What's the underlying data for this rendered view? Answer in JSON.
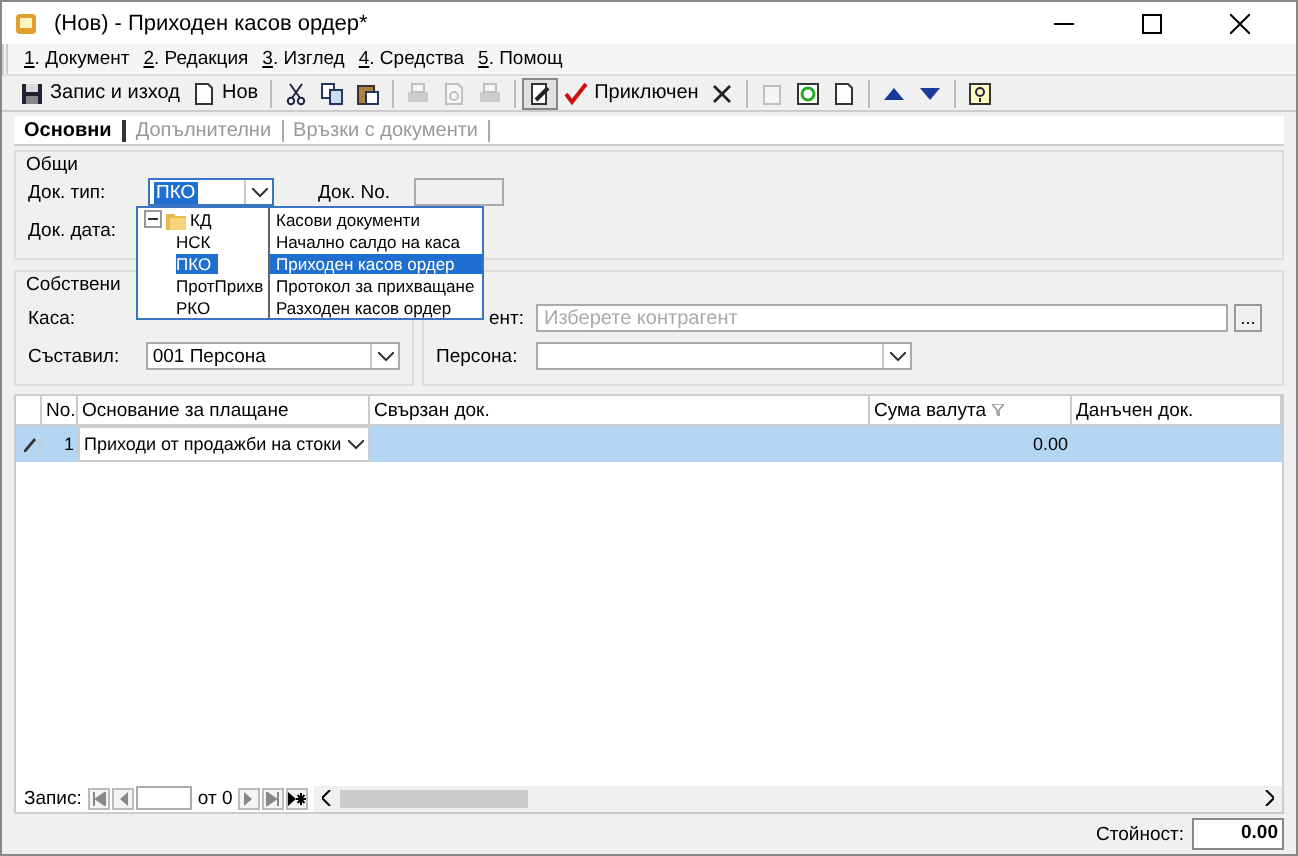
{
  "window": {
    "title": "(Нов) - Приходен касов ордер*"
  },
  "menu": [
    {
      "key": "1",
      "label": ". Документ"
    },
    {
      "key": "2",
      "label": ". Редакция"
    },
    {
      "key": "3",
      "label": ". Изглед"
    },
    {
      "key": "4",
      "label": ". Средства"
    },
    {
      "key": "5",
      "label": ". Помощ"
    }
  ],
  "toolbar": [
    {
      "kind": "button",
      "label": "Запис и изход",
      "disabled": false
    },
    {
      "kind": "button",
      "label": "Нов",
      "disabled": false
    },
    {
      "kind": "separator"
    },
    {
      "kind": "button",
      "disabled": false
    },
    {
      "kind": "button",
      "disabled": false
    },
    {
      "kind": "button",
      "disabled": false
    },
    {
      "kind": "separator"
    },
    {
      "kind": "button",
      "disabled": true
    },
    {
      "kind": "button",
      "disabled": true
    },
    {
      "kind": "button",
      "disabled": true
    },
    {
      "kind": "separator"
    },
    {
      "kind": "toggle",
      "on": true
    },
    {
      "kind": "button",
      "label": "Приключен",
      "disabled": false
    },
    {
      "kind": "button",
      "disabled": false
    },
    {
      "kind": "separator"
    },
    {
      "kind": "button",
      "disabled": true
    },
    {
      "kind": "button",
      "disabled": false
    },
    {
      "kind": "button",
      "disabled": false
    },
    {
      "kind": "separator"
    },
    {
      "kind": "button",
      "disabled": false
    },
    {
      "kind": "button",
      "disabled": false
    },
    {
      "kind": "separator"
    },
    {
      "kind": "button",
      "disabled": false
    }
  ],
  "tabs": [
    {
      "label": "Основни",
      "selected": true
    },
    {
      "label": "Допълнителни",
      "selected": false
    },
    {
      "label": "Връзки с документи",
      "selected": false
    }
  ],
  "general": {
    "title": "Общи",
    "doc_type_label": "Док. тип:",
    "doc_type_value": "ПКО",
    "doc_no_label": "Док. No.",
    "doc_date_label": "Док. дата:"
  },
  "own": {
    "title": "Собствени",
    "cash_label": "Каса:",
    "author_label": "Съставил:",
    "author_value": "001 Персона",
    "contragent_label": "ент:",
    "contragent_placeholder": "Изберете контрагент",
    "more_button": "...",
    "person_label": "Персона:"
  },
  "doc_type_tree": [
    {
      "code": "КД",
      "name": "Касови документи",
      "expanded": true,
      "selected": false,
      "children": [
        {
          "code": "НСК",
          "name": "Начално салдо на каса",
          "selected": false
        },
        {
          "code": "ПКО",
          "name": "Приходен касов ордер",
          "selected": true
        },
        {
          "code": "ПротПрихв",
          "name": "Протокол за прихващане",
          "selected": false
        },
        {
          "code": "РКО",
          "name": "Разходен касов ордер",
          "selected": false
        }
      ]
    }
  ],
  "table": {
    "columns": [
      "No.",
      "Основание за плащане",
      "Свързан док.",
      "Сума валута",
      "Данъчен док."
    ],
    "rows": [
      {
        "selected": true,
        "no": "1",
        "basis": "Приходи от продажби на стоки",
        "linked": "",
        "amount": "0.00",
        "tax_doc": ""
      }
    ]
  },
  "navigator": {
    "label": "Запис:",
    "of": "от 0"
  },
  "footer": {
    "label": "Стойност:",
    "value": "0.00"
  }
}
